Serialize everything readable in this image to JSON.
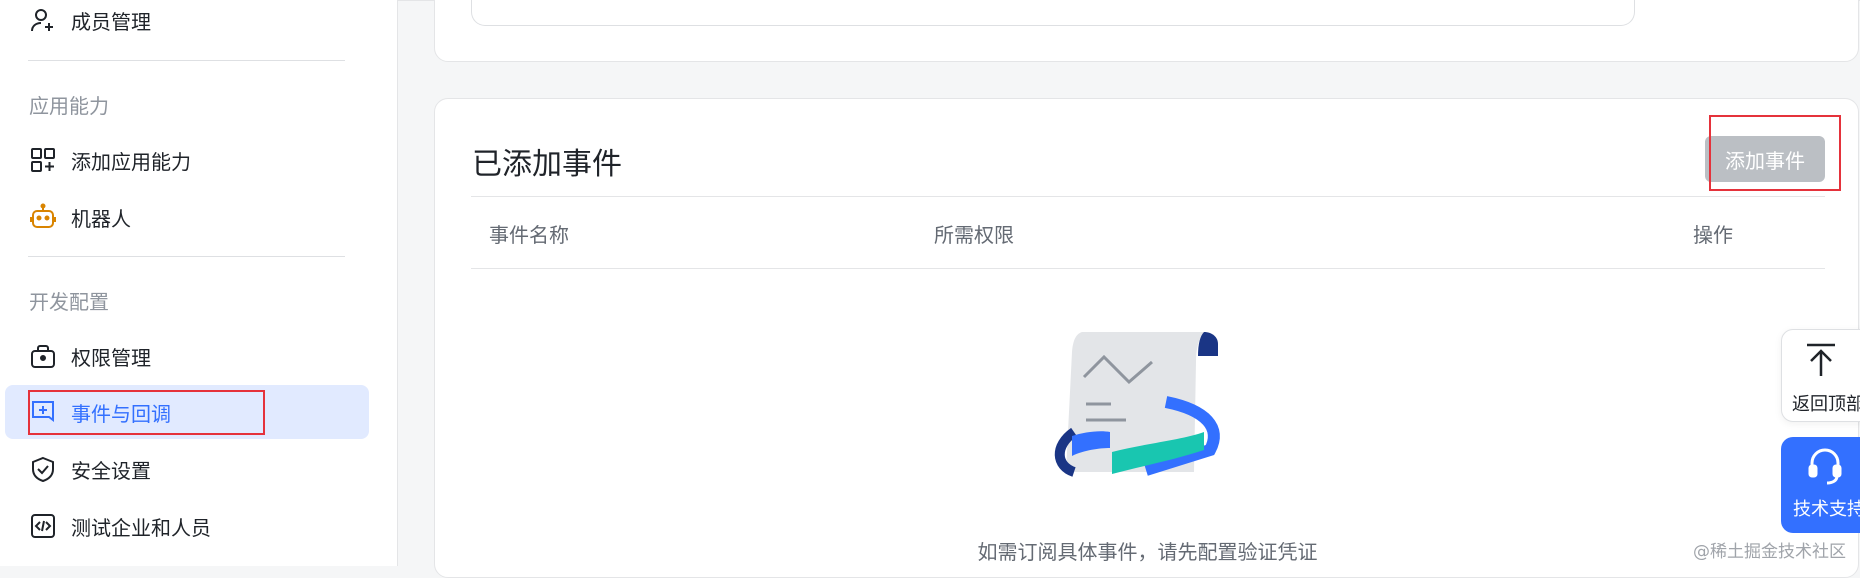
{
  "sidebar": {
    "member_manage": "成员管理",
    "group_app_ability": "应用能力",
    "add_app_ability": "添加应用能力",
    "robot": "机器人",
    "group_dev_config": "开发配置",
    "permission_manage": "权限管理",
    "events_callbacks": "事件与回调",
    "security_settings": "安全设置",
    "test_enterprise_people": "测试企业和人员"
  },
  "events_card": {
    "title": "已添加事件",
    "add_button": "添加事件",
    "columns": [
      "事件名称",
      "所需权限",
      "操作"
    ],
    "empty_message": "如需订阅具体事件，请先配置验证凭证"
  },
  "floating": {
    "back_to_top": "返回顶部",
    "tech_support": "技术支持"
  },
  "watermark": "@稀土掘金技术社区",
  "colors": {
    "accent": "#3370ff",
    "active_bg": "#e1eaff",
    "highlight_red": "#e5323b",
    "disabled_button": "#bbbfc4"
  }
}
